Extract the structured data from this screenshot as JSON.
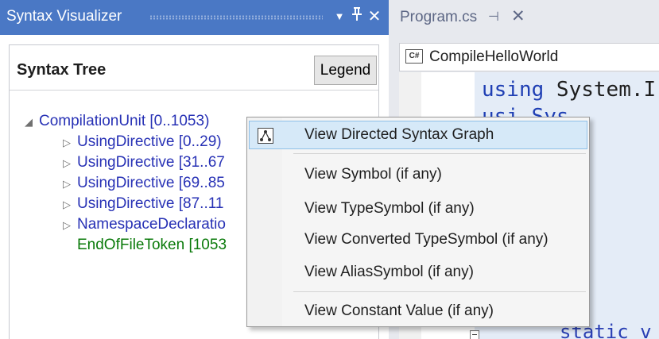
{
  "syntax_visualizer": {
    "title": "Syntax Visualizer",
    "controls": {
      "dropdown": "▼",
      "pin": "ᛘ",
      "close": "✕"
    },
    "syntax_tree_label": "Syntax Tree",
    "legend_button": "Legend",
    "tree": {
      "root": {
        "arrow": "◢",
        "label": "CompilationUnit [0..1053)"
      },
      "children": [
        {
          "arrow": "▷",
          "label": "UsingDirective [0..29)"
        },
        {
          "arrow": "▷",
          "label": "UsingDirective [31..67"
        },
        {
          "arrow": "▷",
          "label": "UsingDirective [69..85"
        },
        {
          "arrow": "▷",
          "label": "UsingDirective [87..11"
        },
        {
          "arrow": "▷",
          "label": "NamespaceDeclaratio"
        },
        {
          "arrow": "",
          "label": "EndOfFileToken [1053"
        }
      ]
    }
  },
  "editor": {
    "tab_title": "Program.cs",
    "tab_pin": "⊣",
    "tab_close": "✕",
    "nav_icon_text": "C#",
    "nav_project": "CompileHelloWorld",
    "code_line1_keyword": "using",
    "code_line1_rest": " System.I",
    "code_line2": "usi   Sys  ",
    "code_last": "static v"
  },
  "context_menu": {
    "items": [
      {
        "label": "View Directed Syntax Graph",
        "icon": "graph-icon",
        "highlighted": true
      },
      {
        "label": "View Symbol (if any)"
      },
      {
        "label": "View TypeSymbol (if any)"
      },
      {
        "label": "View Converted TypeSymbol (if any)"
      },
      {
        "label": "View AliasSymbol (if any)"
      },
      {
        "label": "View Constant Value (if any)"
      }
    ]
  },
  "colors": {
    "tool_window_title": "#4a78c5",
    "tree_node_blue": "#2731b5",
    "tree_token_green": "#0a7a0a",
    "menu_highlight": "#d6e9f8",
    "code_keyword": "#1f3fb4"
  }
}
